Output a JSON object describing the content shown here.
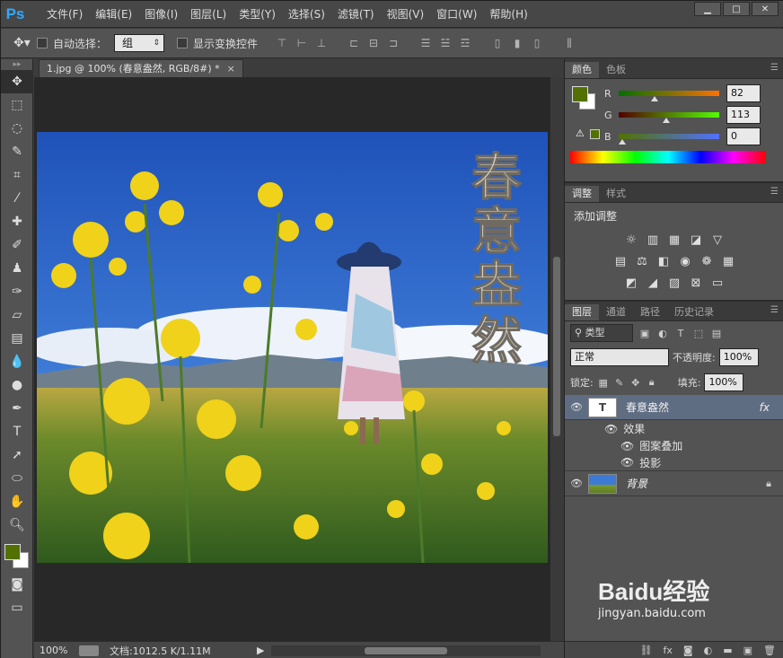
{
  "app": {
    "logo": "Ps"
  },
  "menu": [
    "文件(F)",
    "编辑(E)",
    "图像(I)",
    "图层(L)",
    "类型(Y)",
    "选择(S)",
    "滤镜(T)",
    "视图(V)",
    "窗口(W)",
    "帮助(H)"
  ],
  "window_controls": [
    "minimize-icon",
    "restore-icon",
    "close-icon"
  ],
  "options": {
    "auto_select_label": "自动选择：",
    "auto_select_value": "组",
    "show_transform_label": "显示变换控件"
  },
  "document": {
    "tab_title": "1.jpg @ 100% (春意盎然, RGB/8#) *",
    "close": "×"
  },
  "canvas_text": [
    "春",
    "意",
    "盎",
    "然"
  ],
  "status": {
    "zoom": "100%",
    "doc_info": "文档:1012.5 K/1.11M"
  },
  "color_panel": {
    "tabs": [
      "颜色",
      "色板"
    ],
    "foreground": "#527100",
    "background": "#ffffff",
    "channels": [
      {
        "label": "R",
        "value": "82",
        "fraction": 0.32
      },
      {
        "label": "G",
        "value": "113",
        "fraction": 0.44
      },
      {
        "label": "B",
        "value": "0",
        "fraction": 0.0
      }
    ]
  },
  "adjustments_panel": {
    "tabs": [
      "调整",
      "样式"
    ],
    "title": "添加调整"
  },
  "layers_panel": {
    "tabs": [
      "图层",
      "通道",
      "路径",
      "历史记录"
    ],
    "filter_label": "类型",
    "blend_mode": "正常",
    "opacity_label": "不透明度:",
    "opacity_value": "100%",
    "lock_label": "锁定:",
    "fill_label": "填充:",
    "fill_value": "100%",
    "layers": [
      {
        "name": "春意盎然",
        "type": "text",
        "thumb": "T",
        "fx": "fx",
        "effects_label": "效果",
        "effects": [
          "图案叠加",
          "投影"
        ]
      },
      {
        "name": "背景",
        "type": "image"
      }
    ]
  },
  "watermark": {
    "brand": "Baidu经验",
    "url": "jingyan.baidu.com"
  }
}
